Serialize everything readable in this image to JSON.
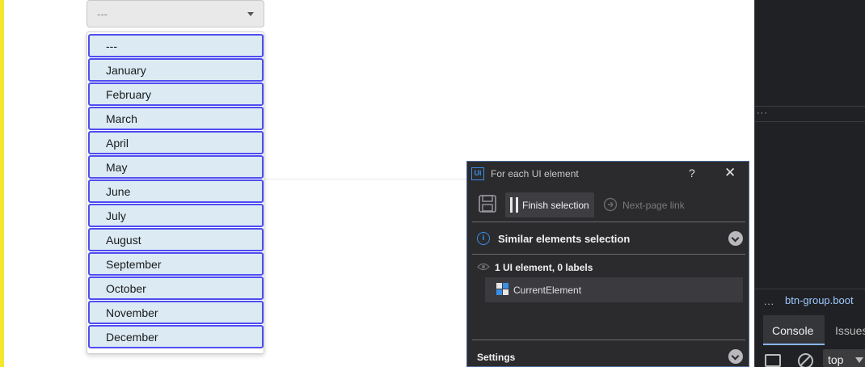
{
  "select": {
    "value": "---",
    "options": [
      "---",
      "January",
      "February",
      "March",
      "April",
      "May",
      "June",
      "July",
      "August",
      "September",
      "October",
      "November",
      "December"
    ]
  },
  "uipath_panel": {
    "logo": "Ui",
    "title": "For each UI element",
    "help": "?",
    "close": "✕",
    "finish_label": "Finish selection",
    "next_label": "Next-page link",
    "similar_label": "Similar elements selection",
    "info_glyph": "i",
    "count_label": "1 UI element, 0 labels",
    "element_label": "CurrentElement",
    "settings_label": "Settings",
    "accent_color": "#3a8ee6"
  },
  "devtools": {
    "dots_top": "···",
    "dots_crumb": "...",
    "crumb": "btn-group.boot",
    "tab_console": "Console",
    "tab_issues": "Issues",
    "context": "top"
  },
  "colors": {
    "option_bg": "#dbeaf3",
    "option_border": "#4f4df0",
    "page_edge": "#f5e72b"
  }
}
